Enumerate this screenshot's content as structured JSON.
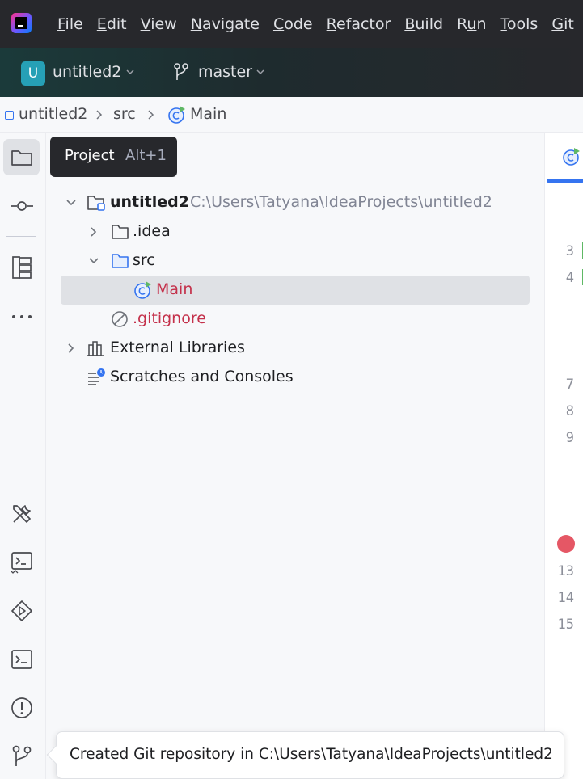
{
  "menubar": {
    "logo_icon": "intellij-idea-logo-icon",
    "items": [
      {
        "label": "File",
        "mnemonic": "F",
        "rest": "ile"
      },
      {
        "label": "Edit",
        "mnemonic": "E",
        "rest": "dit"
      },
      {
        "label": "View",
        "mnemonic": "V",
        "rest": "iew"
      },
      {
        "label": "Navigate",
        "mnemonic": "N",
        "rest": "avigate"
      },
      {
        "label": "Code",
        "mnemonic": "C",
        "rest": "ode"
      },
      {
        "label": "Refactor",
        "mnemonic": "R",
        "rest": "efactor"
      },
      {
        "label": "Build",
        "mnemonic": "B",
        "rest": "uild"
      },
      {
        "label": "Run",
        "pre": "R",
        "mnemonic": "u",
        "rest": "n"
      },
      {
        "label": "Tools",
        "mnemonic": "T",
        "rest": "ools"
      },
      {
        "label": "Git",
        "mnemonic": "G",
        "rest": "it"
      }
    ]
  },
  "toolbar": {
    "project_badge": "U",
    "project_name": "untitled2",
    "branch_name": "master"
  },
  "breadcrumb": {
    "items": [
      "untitled2",
      "src",
      "Main"
    ]
  },
  "tooltip": {
    "title": "Project",
    "shortcut": "Alt+1"
  },
  "tree": {
    "root_name": "untitled2",
    "root_path": "C:\\Users\\Tatyana\\IdeaProjects\\untitled2",
    "idea_folder": ".idea",
    "src_folder": "src",
    "main_class": "Main",
    "gitignore": ".gitignore",
    "external_libraries": "External Libraries",
    "scratches": "Scratches and Consoles"
  },
  "editor": {
    "line_numbers": [
      "3",
      "4",
      "7",
      "8",
      "9",
      "13",
      "14",
      "15"
    ]
  },
  "notification": {
    "message": "Created Git repository in C:\\Users\\Tatyana\\IdeaProjects\\untitled2"
  },
  "colors": {
    "accent": "#3574f0",
    "project_badge": "#26a0b6",
    "breakpoint": "#e55765",
    "vcs_untracked": "#c4314b"
  }
}
